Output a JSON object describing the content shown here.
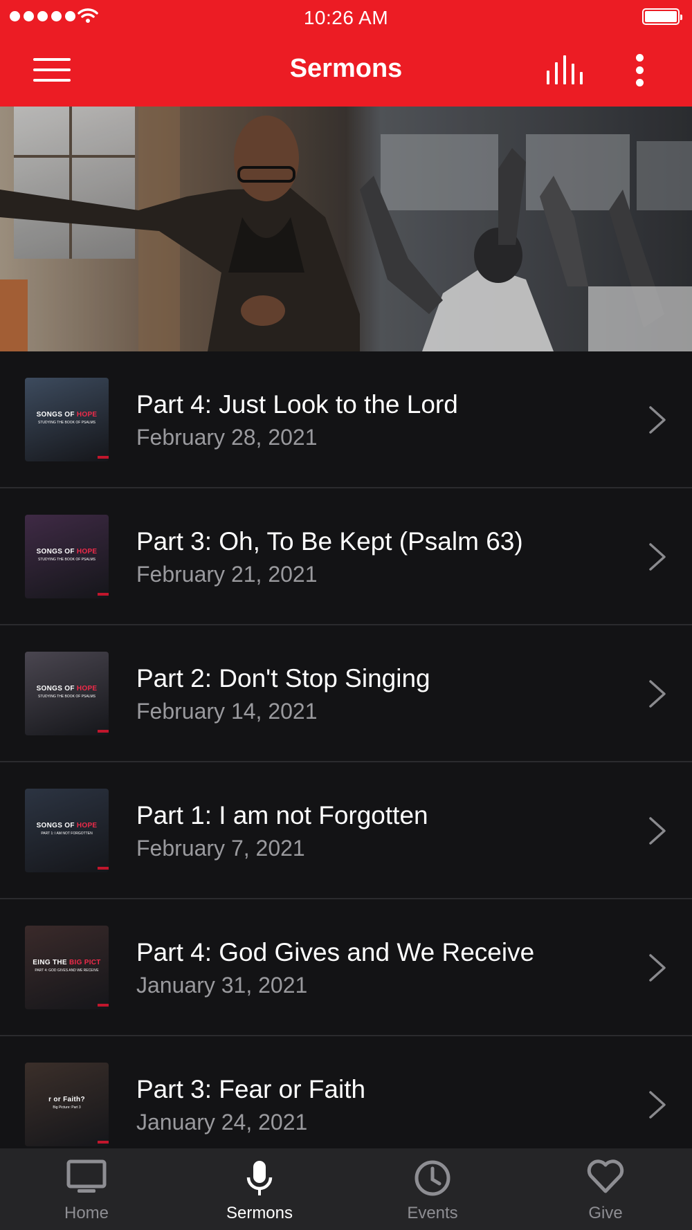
{
  "status_bar": {
    "time": "10:26 AM"
  },
  "nav": {
    "title": "Sermons"
  },
  "icons": {
    "menu": "hamburger-menu-icon",
    "audio": "audio-bars-icon",
    "more": "vertical-ellipsis-icon",
    "chevron": "chevron-right-icon"
  },
  "colors": {
    "brand_red": "#ec1c24",
    "background": "#131315",
    "tabbar": "#252527",
    "subtitle_gray": "#9a9a9e"
  },
  "sermons": [
    {
      "title": "Part 4:  Just Look to the Lord",
      "date": "February 28, 2021",
      "thumb": {
        "line1a": "SONGS ",
        "line1b": "OF ",
        "line1c": "HOPE",
        "line2": "STUDYING THE BOOK OF PSALMS"
      }
    },
    {
      "title": "Part 3: Oh, To Be Kept (Psalm 63)",
      "date": "February 21, 2021",
      "thumb": {
        "line1a": "SONGS ",
        "line1b": "OF ",
        "line1c": "HOPE",
        "line2": "STUDYING THE BOOK OF PSALMS"
      }
    },
    {
      "title": "Part 2: Don't Stop Singing",
      "date": "February 14, 2021",
      "thumb": {
        "line1a": "SONGS ",
        "line1b": "OF ",
        "line1c": "HOPE",
        "line2": "STUDYING THE BOOK OF PSALMS"
      }
    },
    {
      "title": "Part 1:  I am not Forgotten",
      "date": "February 7, 2021",
      "thumb": {
        "line1a": "SONGS ",
        "line1b": "OF ",
        "line1c": "HOPE",
        "line2": "PART 1: I AM NOT FORGOTTEN"
      }
    },
    {
      "title": "Part 4:  God Gives and We Receive",
      "date": "January 31, 2021",
      "thumb": {
        "line1a": "EING THE ",
        "line1b": "",
        "line1c": "BIG PICT",
        "line2": "PART 4: GOD GIVES AND WE RECEIVE"
      }
    },
    {
      "title": "Part 3:  Fear or Faith",
      "date": "January 24, 2021",
      "thumb": {
        "line1a": "r or Faith?",
        "line1b": "",
        "line1c": "",
        "line2": "Big Picture: Part 3"
      }
    }
  ],
  "tabs": [
    {
      "label": "Home",
      "icon": "tv-icon",
      "active": false
    },
    {
      "label": "Sermons",
      "icon": "microphone-icon",
      "active": true
    },
    {
      "label": "Events",
      "icon": "clock-icon",
      "active": false
    },
    {
      "label": "Give",
      "icon": "heart-icon",
      "active": false
    }
  ]
}
